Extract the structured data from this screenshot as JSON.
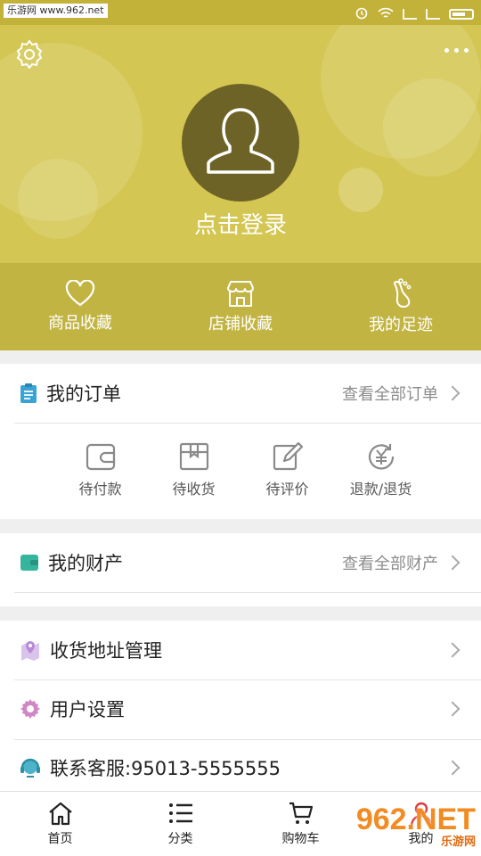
{
  "status_bar": {
    "watermark": "乐游网 www.962.net"
  },
  "header": {
    "login_label": "点击登录",
    "favorites": [
      {
        "label": "商品收藏",
        "icon": "heart-icon"
      },
      {
        "label": "店铺收藏",
        "icon": "shop-icon"
      },
      {
        "label": "我的足迹",
        "icon": "footprint-icon"
      }
    ]
  },
  "orders": {
    "title": "我的订单",
    "view_all": "查看全部订单",
    "items": [
      {
        "label": "待付款",
        "icon": "wallet-icon"
      },
      {
        "label": "待收货",
        "icon": "box-icon"
      },
      {
        "label": "待评价",
        "icon": "edit-icon"
      },
      {
        "label": "退款/退货",
        "icon": "refund-icon"
      }
    ]
  },
  "assets": {
    "title": "我的财产",
    "view_all": "查看全部财产"
  },
  "menu": [
    {
      "label": "收货地址管理",
      "icon": "map-pin-icon"
    },
    {
      "label": "用户设置",
      "icon": "gear-icon"
    },
    {
      "label": "联系客服:95013-5555555",
      "icon": "headset-icon"
    }
  ],
  "bottom_nav": [
    {
      "label": "首页",
      "icon": "home-icon"
    },
    {
      "label": "分类",
      "icon": "list-icon"
    },
    {
      "label": "购物车",
      "icon": "cart-icon"
    },
    {
      "label": "我的",
      "icon": "user-icon"
    }
  ],
  "watermark_bottom": {
    "main": "962.NET",
    "sub": "乐游网"
  },
  "colors": {
    "header": "#d4c652",
    "accent_orders": "#3aa3d6",
    "accent_assets": "#35b59c",
    "accent_menu": "#b98ad6"
  }
}
